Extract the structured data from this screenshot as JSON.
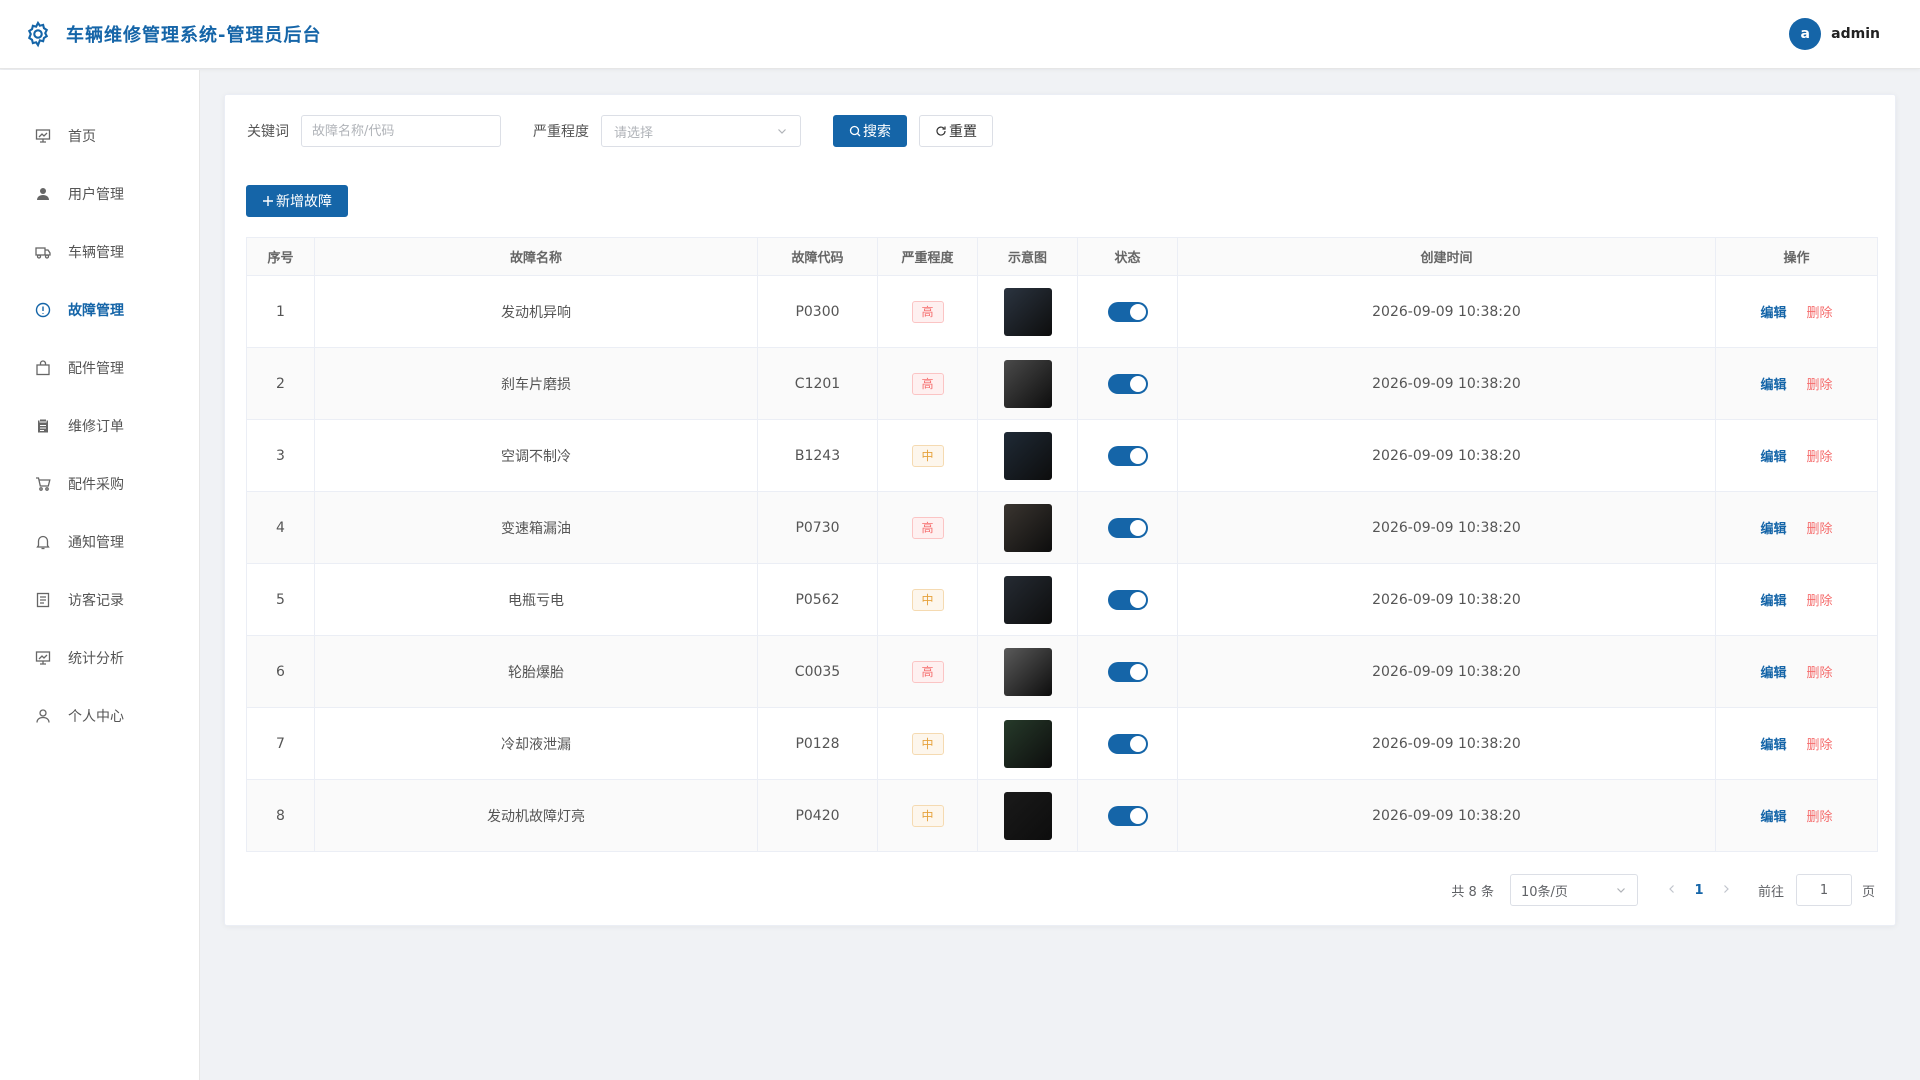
{
  "app": {
    "title": "车辆维修管理系统-管理员后台"
  },
  "user": {
    "avatar_letter": "a",
    "name": "admin"
  },
  "sidebar": {
    "items": [
      {
        "label": "首页",
        "icon": "dashboard-icon"
      },
      {
        "label": "用户管理",
        "icon": "user-icon"
      },
      {
        "label": "车辆管理",
        "icon": "truck-icon"
      },
      {
        "label": "故障管理",
        "icon": "warning-circle-icon",
        "active": true
      },
      {
        "label": "配件管理",
        "icon": "bag-icon"
      },
      {
        "label": "维修订单",
        "icon": "clipboard-icon"
      },
      {
        "label": "配件采购",
        "icon": "cart-icon"
      },
      {
        "label": "通知管理",
        "icon": "bell-icon"
      },
      {
        "label": "访客记录",
        "icon": "document-icon"
      },
      {
        "label": "统计分析",
        "icon": "chart-icon"
      },
      {
        "label": "个人中心",
        "icon": "person-icon"
      }
    ]
  },
  "filter": {
    "keyword_label": "关键词",
    "keyword_placeholder": "故障名称/代码",
    "severity_label": "严重程度",
    "severity_placeholder": "请选择",
    "search_label": "搜索",
    "reset_label": "重置"
  },
  "toolbar": {
    "add_label": "新增故障"
  },
  "table": {
    "headers": [
      "序号",
      "故障名称",
      "故障代码",
      "严重程度",
      "示意图",
      "状态",
      "创建时间",
      "操作"
    ],
    "edit_label": "编辑",
    "delete_label": "删除",
    "rows": [
      {
        "index": "1",
        "name": "发动机异响",
        "code": "P0300",
        "severity": "高",
        "level": "high",
        "enabled": true,
        "created": "2026-09-09 10:38:20",
        "thumb_color": "#2b3440"
      },
      {
        "index": "2",
        "name": "刹车片磨损",
        "code": "C1201",
        "severity": "高",
        "level": "high",
        "enabled": true,
        "created": "2026-09-09 10:38:20",
        "thumb_color": "#4a4a4a"
      },
      {
        "index": "3",
        "name": "空调不制冷",
        "code": "B1243",
        "severity": "中",
        "level": "mid",
        "enabled": true,
        "created": "2026-09-09 10:38:20",
        "thumb_color": "#1f2a36"
      },
      {
        "index": "4",
        "name": "变速箱漏油",
        "code": "P0730",
        "severity": "高",
        "level": "high",
        "enabled": true,
        "created": "2026-09-09 10:38:20",
        "thumb_color": "#3a3530"
      },
      {
        "index": "5",
        "name": "电瓶亏电",
        "code": "P0562",
        "severity": "中",
        "level": "mid",
        "enabled": true,
        "created": "2026-09-09 10:38:20",
        "thumb_color": "#252b33"
      },
      {
        "index": "6",
        "name": "轮胎爆胎",
        "code": "C0035",
        "severity": "高",
        "level": "high",
        "enabled": true,
        "created": "2026-09-09 10:38:20",
        "thumb_color": "#5a5a5a"
      },
      {
        "index": "7",
        "name": "冷却液泄漏",
        "code": "P0128",
        "severity": "中",
        "level": "mid",
        "enabled": true,
        "created": "2026-09-09 10:38:20",
        "thumb_color": "#263a2a"
      },
      {
        "index": "8",
        "name": "发动机故障灯亮",
        "code": "P0420",
        "severity": "中",
        "level": "mid",
        "enabled": true,
        "created": "2026-09-09 10:38:20",
        "thumb_color": "#1a1a1a"
      }
    ]
  },
  "pagination": {
    "total_text": "共 8 条",
    "page_size": "10条/页",
    "current_page": "1",
    "goto_label": "前往",
    "goto_value": "1",
    "page_suffix": "页"
  },
  "colors": {
    "primary": "#1565a8",
    "danger": "#f56c6c",
    "warning": "#e6a23c"
  }
}
